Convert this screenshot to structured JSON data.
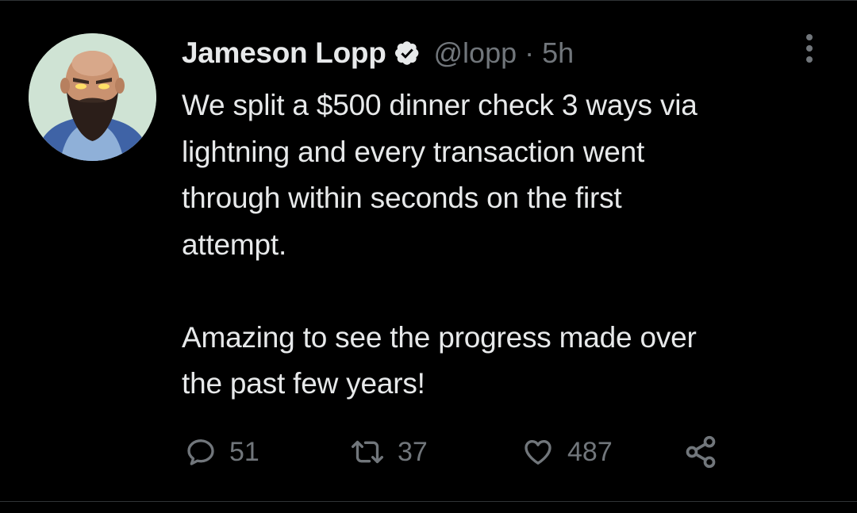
{
  "tweet": {
    "author": {
      "display_name": "Jameson Lopp",
      "handle": "@lopp",
      "verified": true
    },
    "separator": "·",
    "time": "5h",
    "text": "We split a $500 dinner check 3 ways via\nlightning and every transaction went\nthrough within seconds on the first\nattempt.\n\nAmazing to see the progress made over\nthe past few years!",
    "stats": {
      "replies": "51",
      "retweets": "37",
      "likes": "487"
    }
  },
  "icons": {
    "verified": "verified-badge-icon",
    "more": "more-options-icon",
    "reply": "reply-icon",
    "retweet": "retweet-icon",
    "like": "heart-icon",
    "share": "share-icon"
  },
  "colors": {
    "background": "#000000",
    "text_primary": "#e7e9ea",
    "text_secondary": "#71767b",
    "divider": "#2f3336"
  }
}
